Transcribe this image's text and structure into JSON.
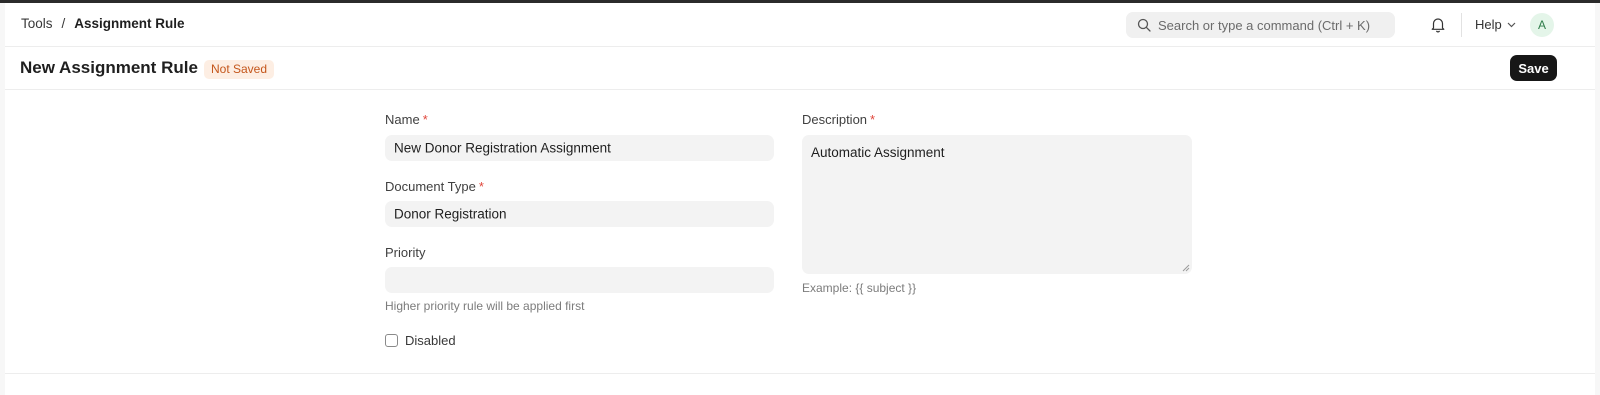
{
  "navbar": {
    "breadcrumbs": [
      "Tools",
      "Assignment Rule"
    ],
    "separator": "/",
    "search_placeholder": "Search or type a command (Ctrl + K)",
    "help_label": "Help",
    "avatar_initial": "A"
  },
  "page": {
    "title": "New Assignment Rule",
    "status": "Not Saved",
    "save_label": "Save"
  },
  "form": {
    "name": {
      "label": "Name",
      "required": "*",
      "value": "New Donor Registration Assignment"
    },
    "document_type": {
      "label": "Document Type",
      "required": "*",
      "value": "Donor Registration"
    },
    "priority": {
      "label": "Priority",
      "value": "",
      "hint": "Higher priority rule will be applied first"
    },
    "disabled": {
      "label": "Disabled",
      "checked": false
    },
    "description": {
      "label": "Description",
      "required": "*",
      "value": "Automatic Assignment",
      "hint": "Example: {{ subject }}"
    }
  },
  "colors": {
    "accent_dark": "#171717",
    "badge_bg": "#fdeee3",
    "badge_text": "#c4561b",
    "required": "#e0463b",
    "field_bg": "#f3f3f3"
  }
}
